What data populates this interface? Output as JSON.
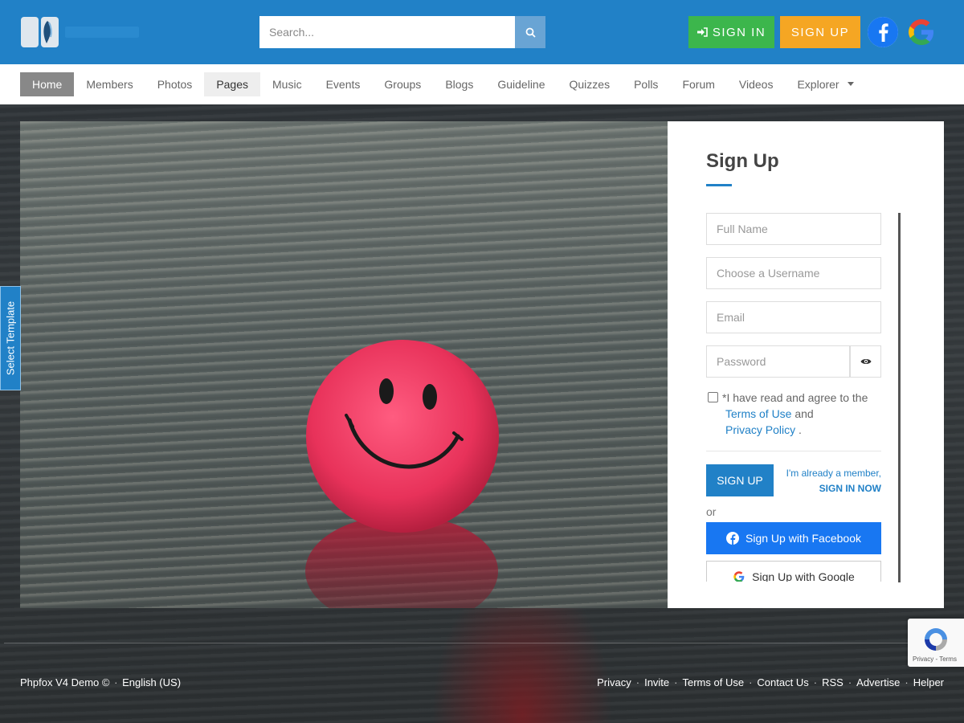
{
  "header": {
    "search_placeholder": "Search...",
    "sign_in_label": "SIGN IN",
    "sign_up_label": "SIGN UP",
    "brand_color": "#2181c7"
  },
  "nav": {
    "items": [
      {
        "label": "Home"
      },
      {
        "label": "Members"
      },
      {
        "label": "Photos"
      },
      {
        "label": "Pages"
      },
      {
        "label": "Music"
      },
      {
        "label": "Events"
      },
      {
        "label": "Groups"
      },
      {
        "label": "Blogs"
      },
      {
        "label": "Guideline"
      },
      {
        "label": "Quizzes"
      },
      {
        "label": "Polls"
      },
      {
        "label": "Forum"
      },
      {
        "label": "Videos"
      },
      {
        "label": "Explorer"
      }
    ]
  },
  "side_tab": {
    "label": "Select Template"
  },
  "signup": {
    "title": "Sign Up",
    "full_name_placeholder": "Full Name",
    "username_placeholder": "Choose a Username",
    "email_placeholder": "Email",
    "password_placeholder": "Password",
    "agree_text": "*I have read and agree to the",
    "terms_link": "Terms of Use",
    "and_text": "and",
    "privacy_link": "Privacy Policy",
    "period": ".",
    "submit_label": "SIGN UP",
    "already_member": "I'm already a member,",
    "sign_in_now": "SIGN IN NOW",
    "or_text": "or",
    "facebook_label": "Sign Up with Facebook",
    "google_label": "Sign Up with Google"
  },
  "footer": {
    "left_text": "Phpfox V4 Demo ©",
    "language": "English (US)",
    "links": [
      "Privacy",
      "Invite",
      "Terms of Use",
      "Contact Us",
      "RSS",
      "Advertise",
      "Helper"
    ]
  },
  "recaptcha": {
    "text": "Privacy - Terms"
  }
}
